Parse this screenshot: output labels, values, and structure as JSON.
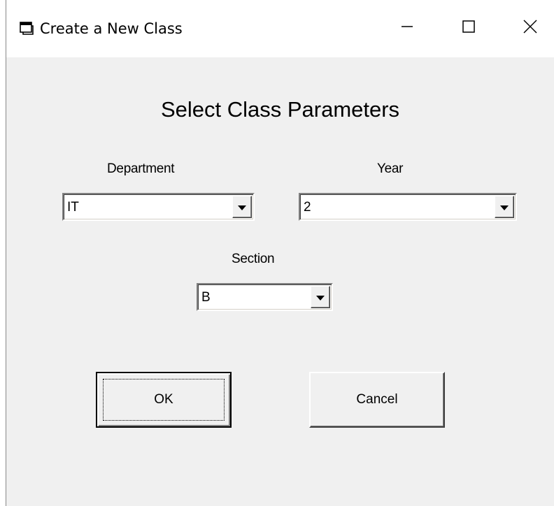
{
  "window": {
    "title": "Create a New Class",
    "icon": "form-icon",
    "controls": {
      "minimize_icon": "minimize-icon",
      "maximize_icon": "maximize-icon",
      "close_icon": "close-icon"
    }
  },
  "form": {
    "heading": "Select Class Parameters",
    "department": {
      "label": "Department",
      "value": "IT"
    },
    "year": {
      "label": "Year",
      "value": "2"
    },
    "section": {
      "label": "Section",
      "value": "B"
    }
  },
  "buttons": {
    "ok_label": "OK",
    "cancel_label": "Cancel"
  },
  "colors": {
    "window_bg": "#f0f0f0",
    "titlebar_bg": "#ffffff"
  }
}
